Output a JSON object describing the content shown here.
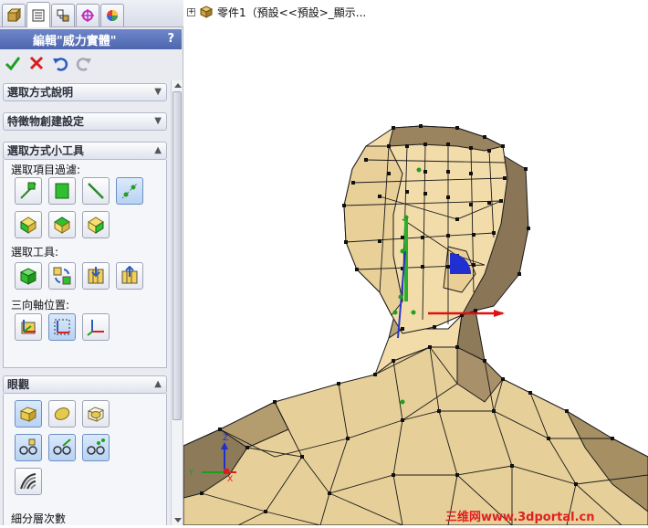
{
  "tabs": [
    {
      "icon": "feature-manager-icon"
    },
    {
      "icon": "property-manager-icon"
    },
    {
      "icon": "configuration-manager-icon"
    },
    {
      "icon": "dimxpert-icon"
    },
    {
      "icon": "display-manager-icon"
    }
  ],
  "property_manager": {
    "title": "編輯\"威力實體\"",
    "help": "?"
  },
  "actions": {
    "ok_icon": "checkmark-icon",
    "cancel_icon": "x-icon",
    "undo_icon": "undo-icon",
    "redo_icon": "redo-icon"
  },
  "groups": {
    "selection_help": "選取方式說明",
    "feature_settings": "特徵物創建設定",
    "selection_tools": "選取方式小工具",
    "display": "眼觀"
  },
  "selection_tools": {
    "filter_label": "選取項目過濾:",
    "tools_label": "選取工具:",
    "triad_label": "三向軸位置:"
  },
  "display": {
    "subdivision_label": "細分層次數"
  },
  "tree": {
    "expander": "+",
    "part_name": "零件1（預設<<預設>_顯示..."
  },
  "triad": {
    "x": "X",
    "y": "Y",
    "z": "Z"
  },
  "watermark": "三维网www.3dportal.cn",
  "colors": {
    "title_bar": "#5470b8",
    "mesh_face": "#efd9a5",
    "mesh_shadow": "#8a7656",
    "accent_green": "#2bb02b",
    "accent_red": "#e01010",
    "accent_blue": "#1f2fd0"
  }
}
